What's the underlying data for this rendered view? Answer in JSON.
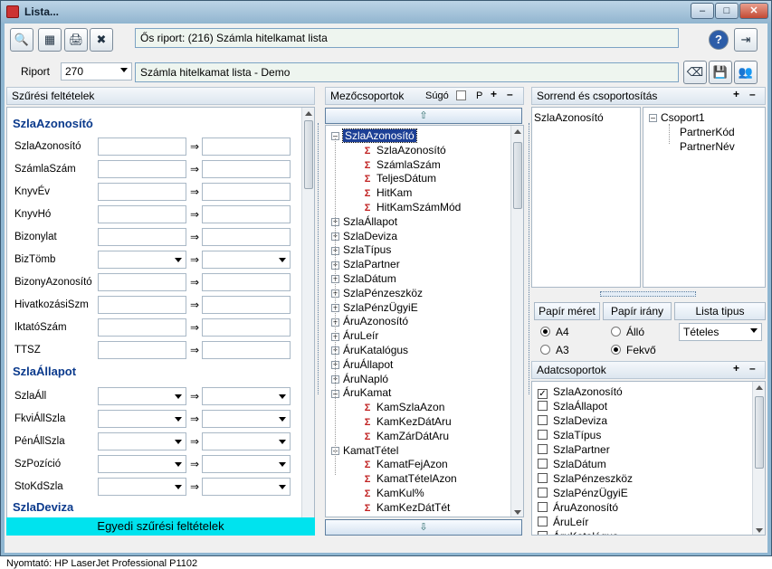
{
  "window": {
    "title": "Lista...",
    "btn_min": "–",
    "btn_max": "□",
    "btn_close": "✕"
  },
  "toolbar": {
    "btn1": "🔍",
    "btn2": "▦",
    "btn3": "🖨",
    "btn4": "✖",
    "help": "?",
    "exit": "⇥"
  },
  "report_title": "Ős riport: (216)  Számla hitelkamat lista",
  "riport": {
    "label": "Riport",
    "value": "270",
    "name": "Számla hitelkamat lista - Demo"
  },
  "filter": {
    "header": "Szűrési feltételek",
    "section1": "SzlaAzonosító",
    "rows1": [
      "SzlaAzonosító",
      "SzámlaSzám",
      "KnyvÉv",
      "KnyvHó",
      "Bizonylat",
      "BizTömb",
      "BizonyAzonosító",
      "HivatkozásiSzm",
      "IktatóSzám",
      "TTSZ"
    ],
    "section2": "SzlaÁllapot",
    "rows2": [
      "SzlaÁll",
      "FkviÁllSzla",
      "PénÁllSzla",
      "SzPozíció",
      "StoKdSzla"
    ],
    "section3": "SzlaDeviza",
    "footer": "Egyedi szűrési feltételek",
    "arrow": "⇒"
  },
  "groups": {
    "header": "Mezőcsoportok",
    "sugo": "Súgó",
    "p": "P",
    "plus": "+",
    "minus": "–",
    "nodes": [
      {
        "t": "SzlaAzonosító",
        "lvl": 0,
        "pm": "–",
        "sel": true
      },
      {
        "t": "SzlaAzonosító",
        "lvl": 1
      },
      {
        "t": "SzámlaSzám",
        "lvl": 1
      },
      {
        "t": "TeljesDátum",
        "lvl": 1
      },
      {
        "t": "HitKam",
        "lvl": 1
      },
      {
        "t": "HitKamSzámMód",
        "lvl": 1
      },
      {
        "t": "SzlaÁllapot",
        "lvl": 0,
        "pm": "+"
      },
      {
        "t": "SzlaDeviza",
        "lvl": 0,
        "pm": "+"
      },
      {
        "t": "SzlaTípus",
        "lvl": 0,
        "pm": "+"
      },
      {
        "t": "SzlaPartner",
        "lvl": 0,
        "pm": "+"
      },
      {
        "t": "SzlaDátum",
        "lvl": 0,
        "pm": "+"
      },
      {
        "t": "SzlaPénzeszköz",
        "lvl": 0,
        "pm": "+"
      },
      {
        "t": "SzlaPénzÜgyiE",
        "lvl": 0,
        "pm": "+"
      },
      {
        "t": "ÁruAzonosító",
        "lvl": 0,
        "pm": "+"
      },
      {
        "t": "ÁruLeír",
        "lvl": 0,
        "pm": "+"
      },
      {
        "t": "ÁruKatalógus",
        "lvl": 0,
        "pm": "+"
      },
      {
        "t": "ÁruÁllapot",
        "lvl": 0,
        "pm": "+"
      },
      {
        "t": "ÁruNapló",
        "lvl": 0,
        "pm": "+"
      },
      {
        "t": "ÁruKamat",
        "lvl": 0,
        "pm": "–"
      },
      {
        "t": "KamSzlaAzon",
        "lvl": 1
      },
      {
        "t": "KamKezDátAru",
        "lvl": 1
      },
      {
        "t": "KamZárDátAru",
        "lvl": 1
      },
      {
        "t": "KamatTétel",
        "lvl": 0,
        "pm": "–"
      },
      {
        "t": "KamatFejAzon",
        "lvl": 1
      },
      {
        "t": "KamatTételAzon",
        "lvl": 1
      },
      {
        "t": "KamKul%",
        "lvl": 1
      },
      {
        "t": "KamKezDátTét",
        "lvl": 1
      }
    ]
  },
  "sort": {
    "header": "Sorrend és csoportosítás",
    "plus": "+",
    "minus": "–",
    "left_item": "SzlaAzonosító",
    "group": "Csoport1",
    "children": [
      "PartnerKód",
      "PartnerNév"
    ]
  },
  "paper": {
    "size_label": "Papír méret",
    "dir_label": "Papír irány",
    "type_label": "Lista tipus",
    "a4": "A4",
    "a3": "A3",
    "allo": "Álló",
    "fekvo": "Fekvő",
    "type_value": "Tételes"
  },
  "data_groups": {
    "header": "Adatcsoportok",
    "plus": "+",
    "minus": "–",
    "items": [
      {
        "t": "SzlaAzonosító",
        "c": true
      },
      {
        "t": "SzlaÁllapot",
        "c": false
      },
      {
        "t": "SzlaDeviza",
        "c": false
      },
      {
        "t": "SzlaTípus",
        "c": false
      },
      {
        "t": "SzlaPartner",
        "c": false
      },
      {
        "t": "SzlaDátum",
        "c": false
      },
      {
        "t": "SzlaPénzeszköz",
        "c": false
      },
      {
        "t": "SzlaPénzÜgyiE",
        "c": false
      },
      {
        "t": "ÁruAzonosító",
        "c": false
      },
      {
        "t": "ÁruLeír",
        "c": false
      },
      {
        "t": "ÁruKatalógus",
        "c": false
      }
    ]
  },
  "status": "Nyomtató: HP LaserJet Professional P1102"
}
